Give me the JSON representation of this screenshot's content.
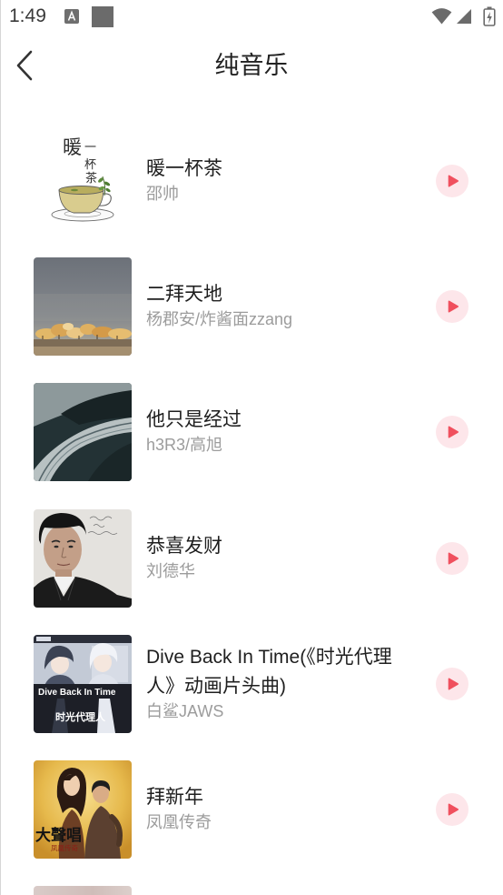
{
  "status_bar": {
    "time": "1:49",
    "left_icons": [
      "text-a-icon",
      "notification-square-icon"
    ],
    "right_icons": [
      "wifi-icon",
      "cellular-signal-icon",
      "battery-charging-icon"
    ]
  },
  "header": {
    "back_icon": "chevron-left-icon",
    "title": "纯音乐"
  },
  "songs": [
    {
      "title": "暖一杯茶",
      "artist": "邵帅",
      "cover_lettering": [
        "暖",
        "一",
        "杯",
        "茶"
      ],
      "action_icon": "play-icon"
    },
    {
      "title": "二拜天地",
      "artist": "杨郡安/炸酱面zzang",
      "action_icon": "play-icon"
    },
    {
      "title": "他只是经过",
      "artist": "h3R3/高旭",
      "action_icon": "play-icon"
    },
    {
      "title": "恭喜发财",
      "artist": "刘德华",
      "action_icon": "play-icon"
    },
    {
      "title": "Dive Back In Time(《时光代理人》动画片头曲)",
      "artist": "白鲨JAWS",
      "cover_lettering": [
        "Dive Back In Time",
        "时光代理人"
      ],
      "action_icon": "play-icon"
    },
    {
      "title": "拜新年",
      "artist": "凤凰传奇",
      "cover_lettering": [
        "大聲唱",
        "凤凰传奇"
      ],
      "action_icon": "play-icon"
    }
  ],
  "colors": {
    "accent": "#f0505e",
    "play_button_background": "#fde6ea",
    "title_text": "#1f1f1f",
    "artist_text": "#9c9c9c",
    "status_icons": "#6b6b6b",
    "background": "#ffffff"
  }
}
